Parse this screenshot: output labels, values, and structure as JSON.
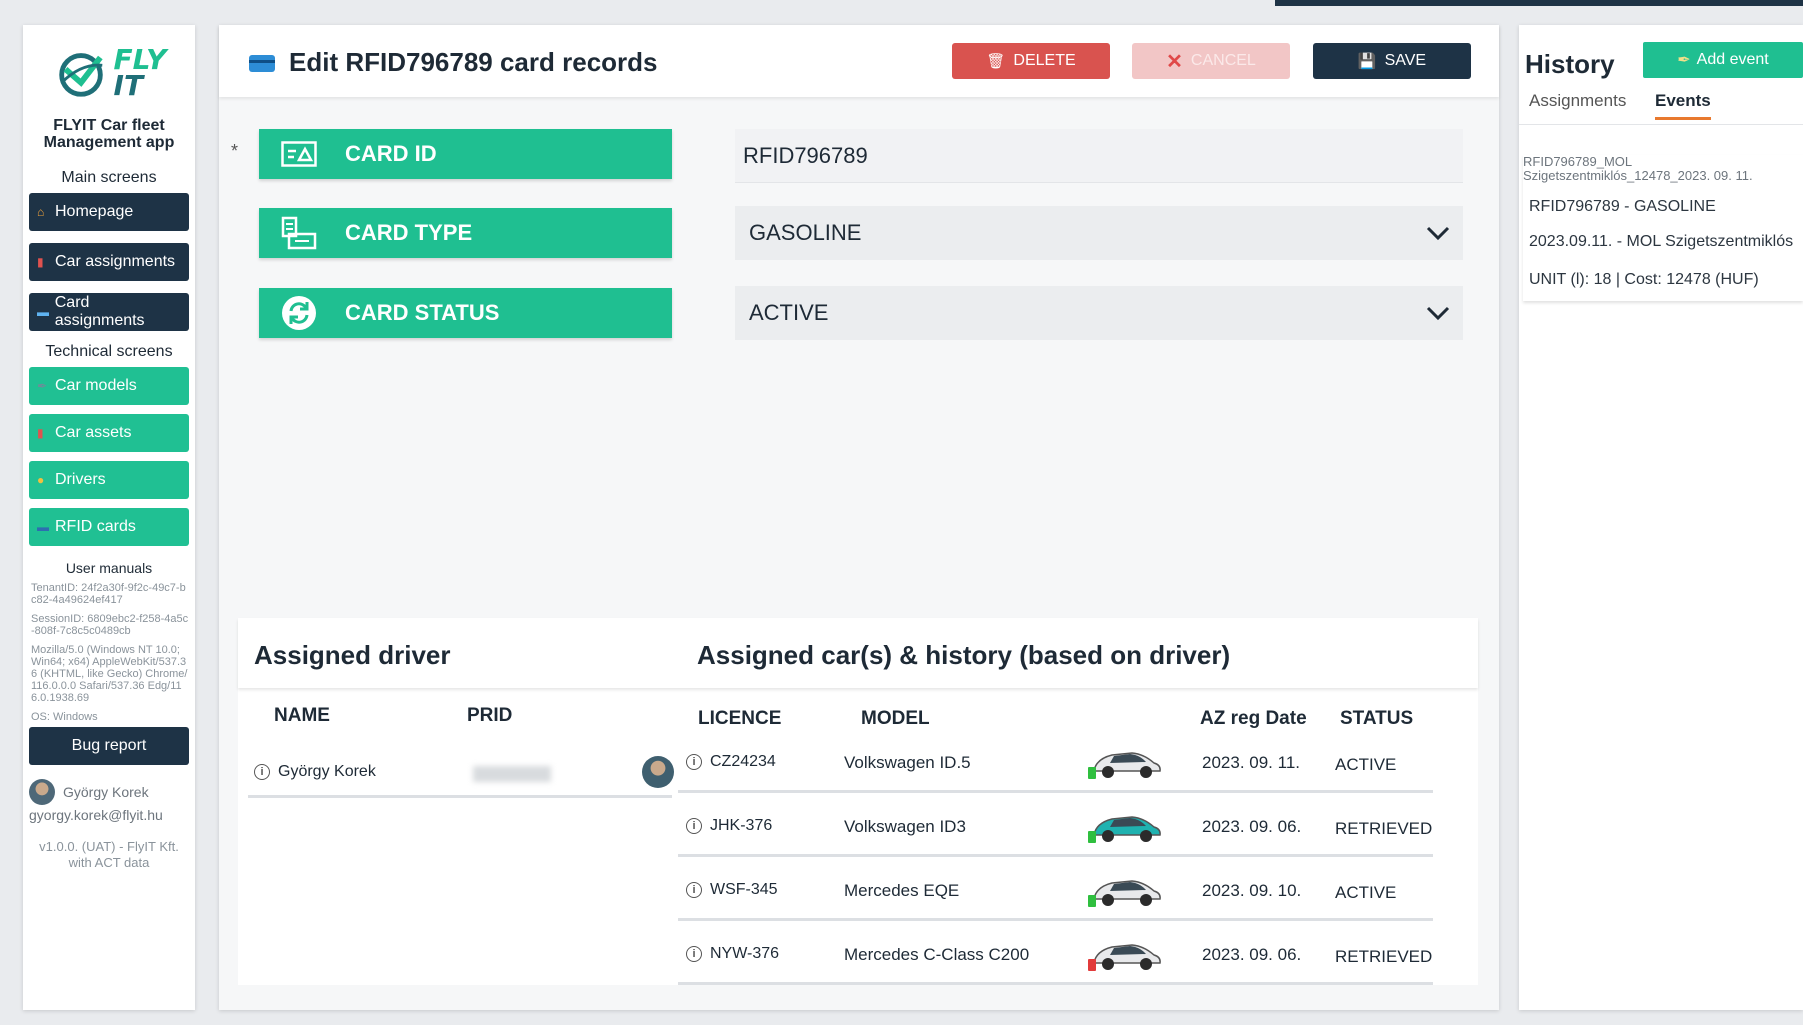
{
  "sidebar": {
    "logo_text_1": "FLY",
    "logo_text_2": "IT",
    "app_title": "FLYIT Car fleet Management app",
    "main_screens_label": "Main screens",
    "main_items": [
      {
        "label": "Homepage",
        "icon": "home-icon"
      },
      {
        "label": "Car assignments",
        "icon": "car-icon"
      },
      {
        "label": "Card assignments",
        "icon": "card-icon"
      }
    ],
    "technical_screens_label": "Technical screens",
    "technical_items": [
      {
        "label": "Car models",
        "icon": "wrench-icon"
      },
      {
        "label": "Car assets",
        "icon": "car-icon"
      },
      {
        "label": "Drivers",
        "icon": "person-icon"
      },
      {
        "label": "RFID cards",
        "icon": "card-icon"
      }
    ],
    "user_manuals_label": "User manuals",
    "tenant_id": "TenantID: 24f2a30f-9f2c-49c7-bc82-4a49624ef417",
    "session_id": "SessionID: 6809ebc2-f258-4a5c-808f-7c8c5c0489cb",
    "user_agent": "Mozilla/5.0 (Windows NT 10.0; Win64; x64) AppleWebKit/537.36 (KHTML, like Gecko) Chrome/116.0.0.0 Safari/537.36 Edg/116.0.1938.69",
    "os": "OS: Windows",
    "bug_report_label": "Bug report",
    "user_name": "György Korek",
    "user_email": "gyorgy.korek@flyit.hu",
    "version": "v1.0.0. (UAT) - FlyIT Kft. with ACT data"
  },
  "header": {
    "title": "Edit RFID796789 card records",
    "delete_label": "DELETE",
    "cancel_label": "CANCEL",
    "save_label": "SAVE"
  },
  "form": {
    "required_mark": "*",
    "card_id_label": "CARD ID",
    "card_id_value": "RFID796789",
    "card_type_label": "CARD TYPE",
    "card_type_value": "GASOLINE",
    "card_status_label": "CARD STATUS",
    "card_status_value": "ACTIVE"
  },
  "assigned_driver": {
    "title": "Assigned driver",
    "columns": [
      "NAME",
      "PRID"
    ],
    "rows": [
      {
        "name": "György Korek"
      }
    ]
  },
  "assigned_cars": {
    "title": "Assigned car(s) & history (based on driver)",
    "columns": [
      "LICENCE",
      "MODEL",
      "AZ reg Date",
      "STATUS"
    ],
    "rows": [
      {
        "licence": "CZ24234",
        "model": "Volkswagen ID.5",
        "date": "2023. 09. 11.",
        "status": "ACTIVE",
        "car_color": "#e8e9eb",
        "badge_color": "#2fbf3f"
      },
      {
        "licence": "JHK-376",
        "model": "Volkswagen ID3",
        "date": "2023. 09. 06.",
        "status": "RETRIEVED",
        "car_color": "#1fb2b0",
        "badge_color": "#2fbf3f"
      },
      {
        "licence": "WSF-345",
        "model": "Mercedes EQE",
        "date": "2023. 09. 10.",
        "status": "ACTIVE",
        "car_color": "#e8e9eb",
        "badge_color": "#2fbf3f"
      },
      {
        "licence": "NYW-376",
        "model": "Mercedes C-Class C200",
        "date": "2023. 09. 06.",
        "status": "RETRIEVED",
        "car_color": "#e8e9eb",
        "badge_color": "#e23b3b"
      }
    ]
  },
  "history": {
    "title": "History",
    "add_event_label": "Add event",
    "tabs": [
      "Assignments",
      "Events"
    ],
    "active_tab": "Events",
    "event": {
      "head": "RFID796789_MOL Szigetszentmiklós_12478_2023. 09. 11.",
      "line1": "RFID796789 - GASOLINE",
      "line2": "2023.09.11. - MOL Szigetszentmiklós",
      "line3": "UNIT (l): 18 | Cost: 12478 (HUF)"
    }
  },
  "colors": {
    "accent_green": "#1fbf91",
    "navy": "#1e3346",
    "danger": "#d9534f",
    "tab_underline": "#e8792f"
  }
}
